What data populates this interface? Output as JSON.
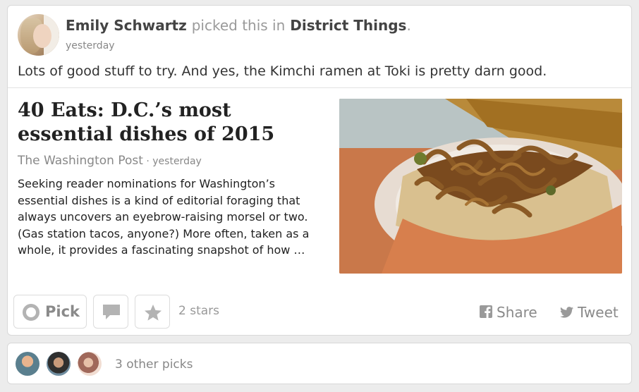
{
  "pick": {
    "user_name": "Emily Schwartz",
    "verb": "picked this in",
    "channel": "District Things",
    "channel_suffix": ".",
    "time": "yesterday",
    "comment": "Lots of good stuff to try. And yes, the Kimchi ramen at Toki is pretty darn good."
  },
  "article": {
    "title": "40 Eats: D.C.’s most essential dishes of 2015",
    "source": "The Washington Post",
    "separator": " · ",
    "date": "yesterday",
    "excerpt": "Seeking reader nominations for Washington’s essential dishes is a kind of editorial foraging that always uncovers an eyebrow-raising morsel or two. (Gas station tacos, anyone?) More often, taken as a whole, it provides a fascinating snapshot of how …"
  },
  "actions": {
    "pick_label": "Pick",
    "stars_label": "2 stars",
    "share_label": "Share",
    "tweet_label": "Tweet"
  },
  "other_picks": {
    "label": "3 other picks"
  },
  "icons": [
    "pick-circle-icon",
    "comment-icon",
    "star-icon",
    "facebook-icon",
    "twitter-icon"
  ]
}
